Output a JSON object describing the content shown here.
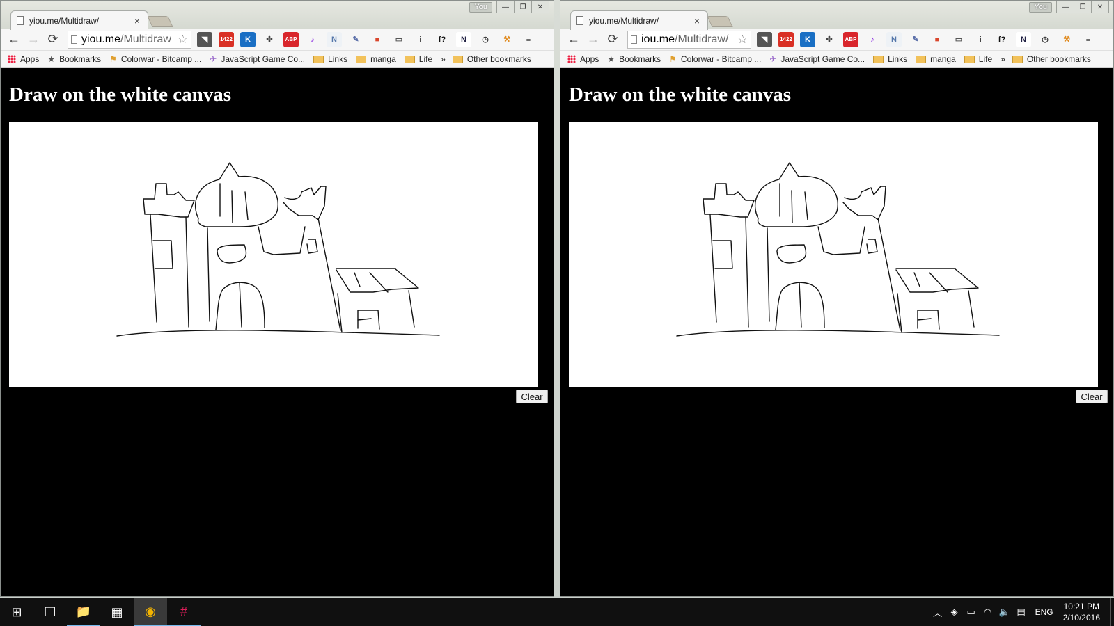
{
  "windows": [
    {
      "tab_title": "yiou.me/Multidraw/",
      "url_host": "yiou.me",
      "url_path": "/Multidraw",
      "profile": "You",
      "heading": "Draw on the white canvas",
      "clear_label": "Clear"
    },
    {
      "tab_title": "yiou.me/Multidraw/",
      "url_host": "iou.me",
      "url_path": "/Multidraw/",
      "profile": "You",
      "heading": "Draw on the white canvas",
      "clear_label": "Clear"
    }
  ],
  "tab_close_glyph": "×",
  "window_controls": {
    "minimize": "—",
    "restore": "❐",
    "close": "✕"
  },
  "nav": {
    "back": "←",
    "forward": "→",
    "reload": "⟳",
    "star": "☆"
  },
  "extensions": [
    {
      "icon": "pocket-icon",
      "text": "◥",
      "bg": "#555555",
      "fg": "#ffffff"
    },
    {
      "icon": "gmail-checker-icon",
      "text": "1422",
      "bg": "#d93025",
      "fg": "#ffffff"
    },
    {
      "icon": "k-extension-icon",
      "text": "K",
      "bg": "#1a6fc4",
      "fg": "#ffffff"
    },
    {
      "icon": "puzzle-icon",
      "text": "✣",
      "bg": "#f6f6f6",
      "fg": "#444444"
    },
    {
      "icon": "adblock-plus-icon",
      "text": "ABP",
      "bg": "#d9262c",
      "fg": "#ffffff"
    },
    {
      "icon": "music-note-icon",
      "text": "♪",
      "bg": "#f6f6f6",
      "fg": "#8a2be2"
    },
    {
      "icon": "n-notes-icon",
      "text": "N",
      "bg": "#eef2f6",
      "fg": "#5577aa"
    },
    {
      "icon": "eyedropper-icon",
      "text": "✎",
      "bg": "#f6f6f6",
      "fg": "#5a6ea8"
    },
    {
      "icon": "bookmark-red-icon",
      "text": "■",
      "bg": "#f6f6f6",
      "fg": "#d9462c"
    },
    {
      "icon": "cast-icon",
      "text": "▭",
      "bg": "#f6f6f6",
      "fg": "#555555"
    },
    {
      "icon": "info-icon",
      "text": "i",
      "bg": "#f6f6f6",
      "fg": "#111111"
    },
    {
      "icon": "font-identify-icon",
      "text": "f?",
      "bg": "#f6f6f6",
      "fg": "#111111"
    },
    {
      "icon": "n-plus-icon",
      "text": "N",
      "bg": "#ffffff",
      "fg": "#222244"
    },
    {
      "icon": "history-icon",
      "text": "◷",
      "bg": "#f6f6f6",
      "fg": "#333333"
    },
    {
      "icon": "hammer-icon",
      "text": "⚒",
      "bg": "#f6f6f6",
      "fg": "#e08a1e"
    },
    {
      "icon": "chrome-menu-icon",
      "text": "≡",
      "bg": "#f6f6f6",
      "fg": "#444444"
    }
  ],
  "bookmarks": [
    {
      "label": "Apps",
      "icon": "apps-grid-icon"
    },
    {
      "label": "Bookmarks",
      "icon": "star-icon"
    },
    {
      "label": "Colorwar - Bitcamp ...",
      "icon": "flag-icon"
    },
    {
      "label": "JavaScript Game Co...",
      "icon": "jet-icon"
    },
    {
      "label": "Links",
      "icon": "folder-icon"
    },
    {
      "label": "manga",
      "icon": "folder-icon"
    },
    {
      "label": "Life",
      "icon": "folder-icon"
    }
  ],
  "bookmarks_more": "»",
  "other_bookmarks": "Other bookmarks",
  "taskbar": {
    "lang": "ENG",
    "time": "10:21 PM",
    "date": "2/10/2016",
    "items": [
      {
        "icon": "windows-start-icon",
        "text": "⊞"
      },
      {
        "icon": "task-view-icon",
        "text": "❐"
      },
      {
        "icon": "file-explorer-icon",
        "text": "📁"
      },
      {
        "icon": "store-icon",
        "text": "▦"
      },
      {
        "icon": "chrome-icon",
        "text": "◉"
      },
      {
        "icon": "slack-icon",
        "text": "#"
      }
    ]
  }
}
